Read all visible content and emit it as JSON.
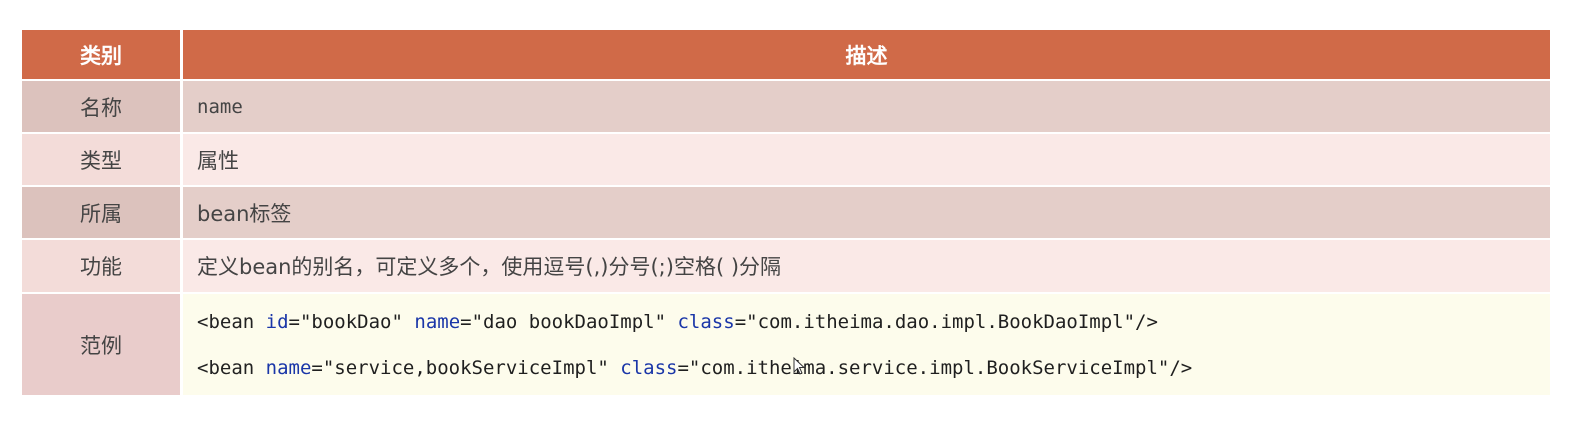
{
  "header": {
    "col1": "类别",
    "col2": "描述"
  },
  "rows": [
    {
      "label": "名称",
      "value": "name"
    },
    {
      "label": "类型",
      "value": "属性"
    },
    {
      "label": "所属",
      "value": "bean标签"
    },
    {
      "label": "功能",
      "value": "定义bean的别名，可定义多个，使用逗号(,)分号(;)空格( )分隔"
    }
  ],
  "example": {
    "label": "范例",
    "line1": {
      "open": "<bean ",
      "attr1": "id",
      "val1": "=\"bookDao\" ",
      "attr2": "name",
      "val2": "=\"dao bookDaoImpl\" ",
      "attr3": "class",
      "val3": "=\"com.itheima.dao.impl.BookDaoImpl\"/>"
    },
    "line2": {
      "open": "<bean ",
      "attr1": "name",
      "val1": "=\"service,bookServiceImpl\" ",
      "attr2": "class",
      "val2": "=\"com.itheima.service.impl.BookServiceImpl\"/>"
    }
  },
  "colors": {
    "header_bg": "#d06a48",
    "attr_blue": "#1a36a8"
  },
  "icons": {
    "cursor": "mouse-pointer-icon"
  }
}
